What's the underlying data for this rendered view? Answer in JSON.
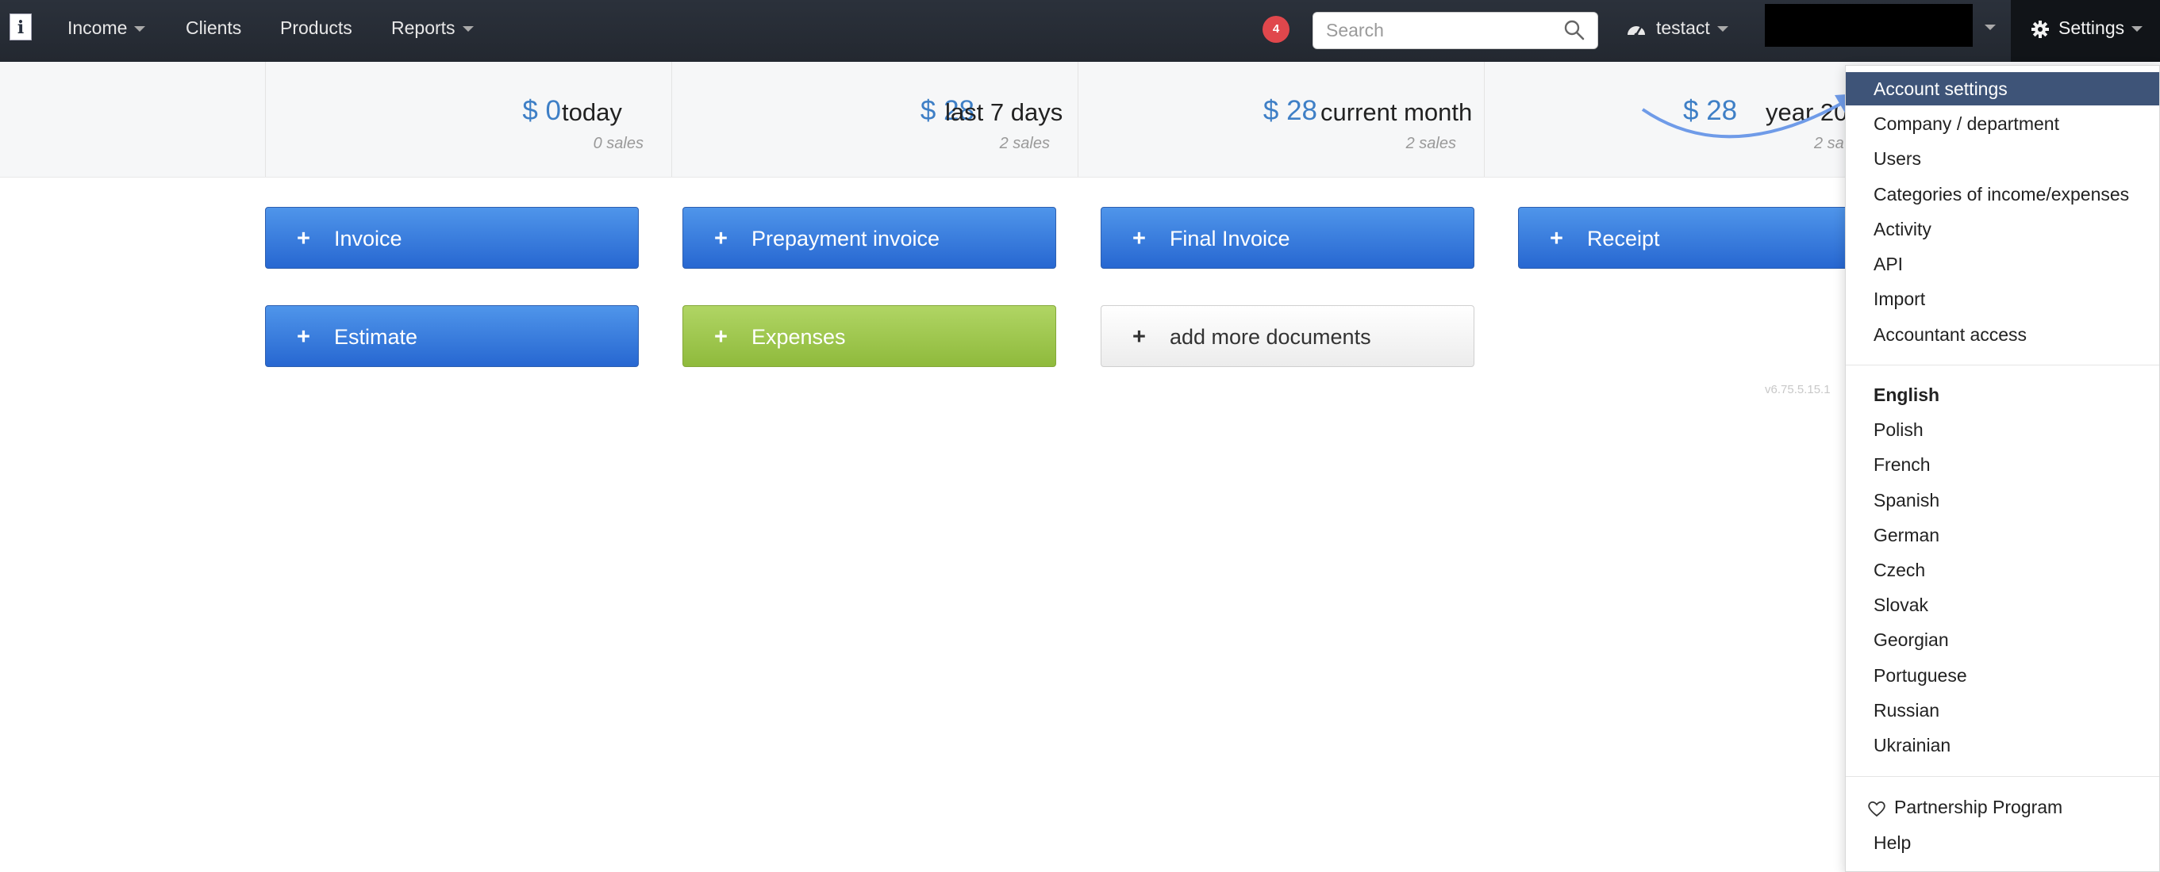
{
  "nav": {
    "logo": "i",
    "income": "Income",
    "clients": "Clients",
    "products": "Products",
    "reports": "Reports",
    "notifications": "4",
    "search_placeholder": "Search",
    "user": "testact",
    "settings": "Settings"
  },
  "stats": [
    {
      "amount": "$ 0",
      "period": "today",
      "count": "0 sales"
    },
    {
      "amount": "$ 28",
      "period": "last 7 days",
      "count": "2 sales"
    },
    {
      "amount": "$ 28",
      "period": "current month",
      "count": "2 sales"
    },
    {
      "amount": "$ 28",
      "period": "year 20",
      "count": "2 sa"
    }
  ],
  "buttons": {
    "invoice": "Invoice",
    "prepayment": "Prepayment invoice",
    "final": "Final Invoice",
    "receipt": "Receipt",
    "estimate": "Estimate",
    "expenses": "Expenses",
    "more": "add more documents"
  },
  "version": "v6.75.5.15.1",
  "settings_menu": {
    "account": "Account settings",
    "company": "Company / department",
    "users": "Users",
    "categories": "Categories of income/expenses",
    "activity": "Activity",
    "api": "API",
    "import": "Import",
    "accountant": "Accountant access",
    "languages": [
      "English",
      "Polish",
      "French",
      "Spanish",
      "German",
      "Czech",
      "Slovak",
      "Georgian",
      "Portuguese",
      "Russian",
      "Ukrainian"
    ],
    "partnership": "Partnership Program",
    "help": "Help"
  },
  "colors": {
    "navbar": "#272c35",
    "primary_blue": "#2f74dc",
    "expenses_green": "#9cc44a",
    "active_item": "#3e5478",
    "amount_blue": "#3e7fc6",
    "badge_red": "#e0474c"
  }
}
